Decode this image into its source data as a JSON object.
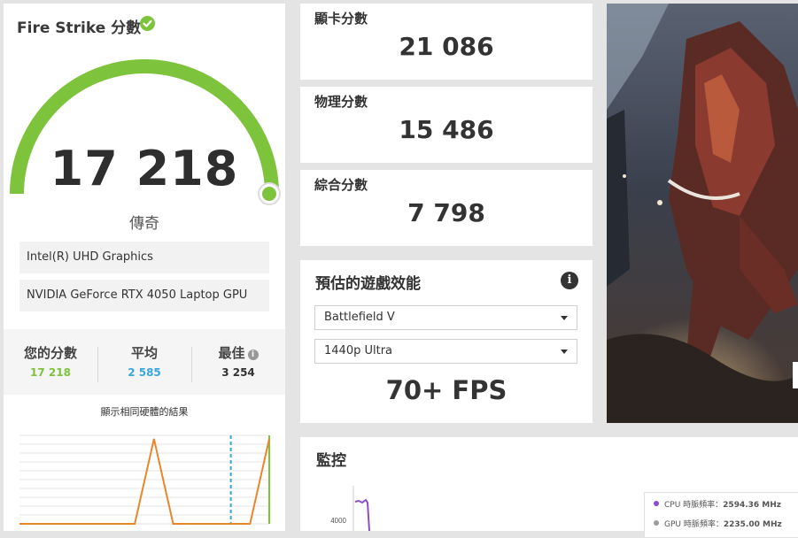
{
  "score_panel": {
    "title": "Fire Strike 分數",
    "score": "17 218",
    "gauge_fraction": 1.0,
    "rank": "傳奇",
    "hardware": [
      "Intel(R) UHD Graphics",
      "NVIDIA GeForce RTX 4050 Laptop GPU"
    ],
    "stats": {
      "yours_label": "您的分數",
      "yours_value": "17 218",
      "avg_label": "平均",
      "avg_value": "2 585",
      "best_label": "最佳",
      "best_value": "3 254"
    },
    "distribution_title": "顯示相同硬體的結果"
  },
  "chart_data": {
    "type": "line",
    "x": [
      0,
      1,
      2,
      3,
      4,
      5,
      6,
      7,
      8,
      9,
      10,
      11,
      12,
      13
    ],
    "series": [
      {
        "values": [
          0,
          0,
          0,
          0,
          0,
          0,
          0,
          1,
          0,
          0,
          0,
          0,
          0,
          1
        ]
      }
    ],
    "markers": {
      "average_index": 11,
      "your_score_index": 13
    },
    "colors": {
      "line": "#e8862c",
      "average": "#3aa6dc",
      "yours": "#7dc33b"
    }
  },
  "sub_scores": [
    {
      "label": "顯卡分數",
      "value": "21 086"
    },
    {
      "label": "物理分數",
      "value": "15 486"
    },
    {
      "label": "綜合分數",
      "value": "7 798"
    }
  ],
  "performance": {
    "title": "預估的遊戲效能",
    "game": "Battlefield V",
    "preset": "1440p Ultra",
    "fps": "70+ FPS"
  },
  "monitor": {
    "title": "監控",
    "y_tick": "4000",
    "legend": [
      {
        "label": "CPU 時脈頻率：",
        "value": "2594.36 MHz",
        "color": "#8a4fc6"
      },
      {
        "label": "GPU 時脈頻率：",
        "value": "2235.00 MHz",
        "color": "#9b9b9b"
      }
    ]
  },
  "colors": {
    "accent_green": "#7dc33b",
    "average_blue": "#3aa6dc",
    "line_orange": "#e8862c"
  }
}
